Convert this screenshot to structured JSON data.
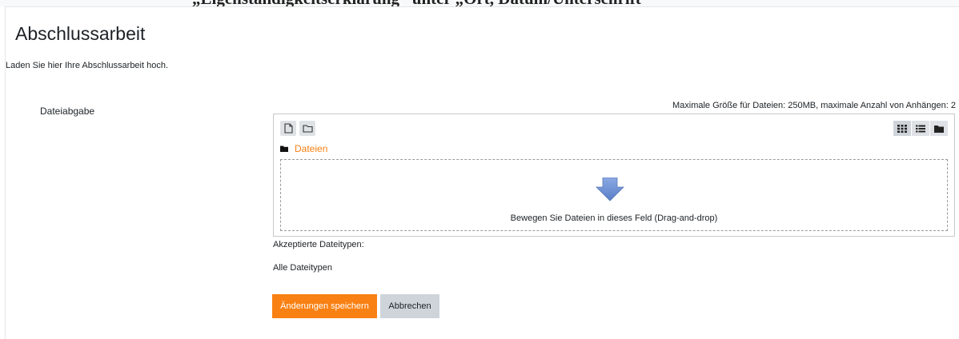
{
  "top_clipped_heading": "„Eigenständigkeitserklärung“ unter „Ort, Datum/Unterschrift“",
  "page_title": "Abschlussarbeit",
  "intro_text": "Laden Sie hier Ihre Abschlussarbeit hoch.",
  "field_label": "Dateiabgabe",
  "max_info": "Maximale Größe für Dateien: 250MB, maximale Anzahl von Anhängen: 2",
  "filepicker": {
    "breadcrumb": "Dateien",
    "dropzone_text": "Bewegen Sie Dateien in dieses Feld (Drag-and-drop)",
    "toolbar_icons": [
      "add-file-icon",
      "create-folder-icon"
    ],
    "view_icons": [
      "grid-view-icon",
      "list-view-icon",
      "tree-view-icon"
    ]
  },
  "accepted_label": "Akzeptierte Dateitypen:",
  "accepted_value": "Alle Dateitypen",
  "buttons": {
    "save": "Änderungen speichern",
    "cancel": "Abbrechen"
  },
  "colors": {
    "accent": "#f98012",
    "secondary_button": "#ced4da",
    "arrow": "#6a8fd2"
  }
}
